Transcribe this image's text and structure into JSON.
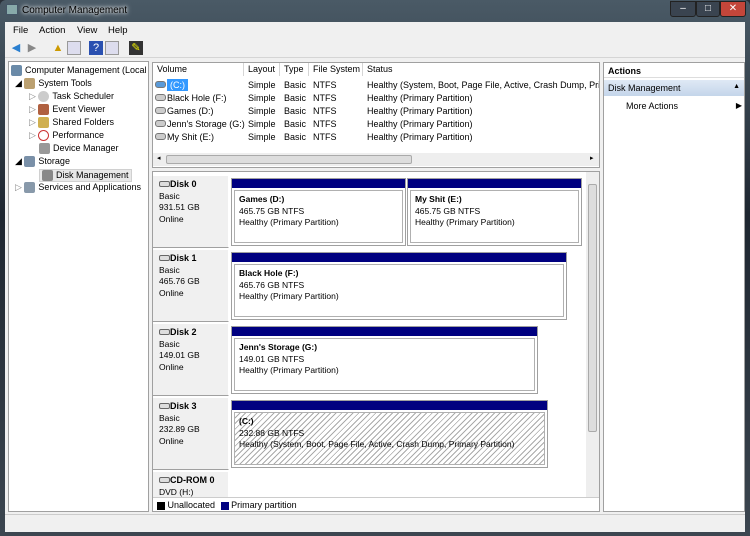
{
  "window": {
    "title": "Computer Management",
    "min": "–",
    "max": "□",
    "close": "✕"
  },
  "menu": [
    "File",
    "Action",
    "View",
    "Help"
  ],
  "tree": {
    "root": "Computer Management (Local",
    "items": [
      {
        "label": "System Tools",
        "icon": "tools-icon"
      },
      {
        "label": "Task Scheduler",
        "icon": "clock-icon"
      },
      {
        "label": "Event Viewer",
        "icon": "event-viewer-icon"
      },
      {
        "label": "Shared Folders",
        "icon": "shared-folder-icon"
      },
      {
        "label": "Performance",
        "icon": "performance-icon"
      },
      {
        "label": "Device Manager",
        "icon": "device-manager-icon"
      },
      {
        "label": "Storage",
        "icon": "storage-icon"
      },
      {
        "label": "Disk Management",
        "icon": "disk-management-icon"
      },
      {
        "label": "Services and Applications",
        "icon": "services-icon"
      }
    ]
  },
  "volumes": {
    "headers": [
      "Volume",
      "Layout",
      "Type",
      "File System",
      "Status"
    ],
    "rows": [
      [
        "(C:)",
        "Simple",
        "Basic",
        "NTFS",
        "Healthy (System, Boot, Page File, Active, Crash Dump, Prim"
      ],
      [
        "Black Hole (F:)",
        "Simple",
        "Basic",
        "NTFS",
        "Healthy (Primary Partition)"
      ],
      [
        "Games (D:)",
        "Simple",
        "Basic",
        "NTFS",
        "Healthy (Primary Partition)"
      ],
      [
        "Jenn's Storage (G:)",
        "Simple",
        "Basic",
        "NTFS",
        "Healthy (Primary Partition)"
      ],
      [
        "My Shit (E:)",
        "Simple",
        "Basic",
        "NTFS",
        "Healthy (Primary Partition)"
      ]
    ]
  },
  "disks": [
    {
      "name": "Disk 0",
      "type": "Basic",
      "size": "931.51 GB",
      "state": "Online",
      "parts": [
        {
          "name": "Games  (D:)",
          "size": "465.75 GB NTFS",
          "status": "Healthy (Primary Partition)"
        },
        {
          "name": "My Shit  (E:)",
          "size": "465.75 GB NTFS",
          "status": "Healthy (Primary Partition)"
        }
      ]
    },
    {
      "name": "Disk 1",
      "type": "Basic",
      "size": "465.76 GB",
      "state": "Online",
      "parts": [
        {
          "name": "Black Hole  (F:)",
          "size": "465.76 GB NTFS",
          "status": "Healthy (Primary Partition)"
        }
      ]
    },
    {
      "name": "Disk 2",
      "type": "Basic",
      "size": "149.01 GB",
      "state": "Online",
      "parts": [
        {
          "name": "Jenn's Storage  (G:)",
          "size": "149.01 GB NTFS",
          "status": "Healthy (Primary Partition)"
        }
      ]
    },
    {
      "name": "Disk 3",
      "type": "Basic",
      "size": "232.89 GB",
      "state": "Online",
      "parts": [
        {
          "name": "(C:)",
          "size": "232.88 GB NTFS",
          "status": "Healthy (System, Boot, Page File, Active, Crash Dump, Primary Partition)"
        }
      ]
    },
    {
      "name": "CD-ROM 0",
      "type": "DVD (H:)"
    }
  ],
  "legend": {
    "unallocated": "Unallocated",
    "primary": "Primary partition",
    "unallocated_color": "#000000",
    "primary_color": "#000080"
  },
  "actions": {
    "title": "Actions",
    "section": "Disk Management",
    "more": "More Actions"
  },
  "colors": {
    "selection": "#cce8ff",
    "partition_bar": "#000080"
  }
}
